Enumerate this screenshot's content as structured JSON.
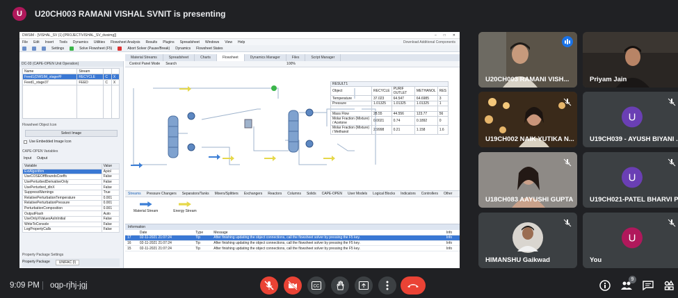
{
  "presenter": {
    "initial": "U",
    "banner": "U20CH003 RAMANI VISHAL SVNIT is presenting"
  },
  "dwsim": {
    "title": "DWSIM - [VISHAL_SV (1) [PROJECT\\VISHAL_SV_dwsimg]]",
    "menu": [
      "File",
      "Edit",
      "Insert",
      "Tools",
      "Dynamics",
      "Utilities",
      "Flowsheet Analysis",
      "Results",
      "Plugins",
      "Spreadsheet",
      "Windows",
      "View",
      "Help"
    ],
    "menu_right": "Download Additional Components",
    "toolbar": [
      "Settings",
      "Solve Flowsheet (F5)",
      "Abort Solver (Pause/Break)",
      "Dynamics",
      "Flowsheet States"
    ],
    "left_title": "DC-03 (CAPE-OPEN Unit Operation)",
    "ports_header": [
      "Name",
      "Stream"
    ],
    "ports": [
      {
        "name": "Feed1(DWSIM_stage#F",
        "stream": "RECYCLE"
      },
      {
        "name": "Feed1_stage37",
        "stream": "FEED"
      }
    ],
    "flowsheet_icon_label": "Flowsheet Object Icon",
    "select_image": "Select Image",
    "embedded_label": "Use Embedded Image Icon",
    "capeopen_vars": "CAPE-OPEN Variables",
    "subtabs": [
      "Input",
      "Output"
    ],
    "var_header": [
      "Variable",
      "Value"
    ],
    "vars": [
      {
        "v": "ExtAlgorithm",
        "val": "Apiol"
      },
      {
        "v": "UseCOSEOffBoundsCoeffs",
        "val": "False"
      },
      {
        "v": "UsePerturbedDerivativeOnly",
        "val": "False"
      },
      {
        "v": "UsePerturbed_dlnX",
        "val": "False"
      },
      {
        "v": "SuppressWarnings",
        "val": "True"
      },
      {
        "v": "RelativePerturbationTemperature",
        "val": "0.001"
      },
      {
        "v": "RelativePerturbationPressure",
        "val": "0.001"
      },
      {
        "v": "PerturbationComposition",
        "val": "0.001"
      },
      {
        "v": "OutputFlash",
        "val": "Auto"
      },
      {
        "v": "UseOnlyXValuesAsInInitial",
        "val": "False"
      },
      {
        "v": "WriteToConsole",
        "val": "False"
      },
      {
        "v": "LogPropertyCalls",
        "val": "False"
      }
    ],
    "prop_settings": "Property Package Settings",
    "prop_package_label": "Property Package",
    "prop_package_value": "UNIFAC (I)",
    "doc_tabs": [
      "Material Streams",
      "Spreadsheet",
      "Charts",
      "Flowsheet",
      "Dynamics Manager",
      "Files",
      "Script Manager"
    ],
    "active_doc_tab": "Flowsheet",
    "fs_toolbar": [
      "Control Panel Mode",
      "Search",
      "100%"
    ],
    "palette_tabs": [
      "Streams",
      "Pressure Changers",
      "Separators/Tanks",
      "Mixers/Splitters",
      "Exchangers",
      "Reactors",
      "Columns",
      "Solids",
      "CAPE-OPEN",
      "User Models",
      "Logical Blocks",
      "Indicators",
      "Controllers",
      "Other"
    ],
    "palette_items": [
      "Material Stream",
      "Energy Stream"
    ],
    "results_title": "RESULT1",
    "results": [
      [
        "Object",
        "RECYCLE",
        "PURIF OUTLET",
        "METHANOL",
        "RES"
      ],
      [
        "Temperature",
        "37.023",
        "64.547",
        "64.6985",
        "3"
      ],
      [
        "Pressure",
        "1.01325",
        "1.01325",
        "1.01325",
        "1"
      ],
      [
        "",
        "",
        "",
        "",
        ""
      ],
      [
        "Mass Flow",
        "28.55",
        "44.556",
        "123.77",
        "56"
      ],
      [
        "Molar Fraction (Mixture) / Acetone",
        "0.0021",
        "0.74",
        "0.1892",
        "0"
      ],
      [
        "Molar Fraction (Mixture) / Methanol",
        "2.9998",
        "0.21",
        "1.158",
        "1.6"
      ]
    ],
    "log_title": "Information",
    "log_header": [
      "",
      "Date",
      "Type",
      "Message",
      "Info"
    ],
    "log_rows": [
      {
        "n": "17",
        "date": "02-11-2021 21:07:24",
        "type": "Tip",
        "msg": "After finishing updating the object connections, call the flowsheet solver by pressing the F5 key.",
        "info": "Info"
      },
      {
        "n": "16",
        "date": "02-11-2021 21:07:24",
        "type": "Tip",
        "msg": "After finishing updating the object connections, call the flowsheet solver by pressing the F5 key.",
        "info": "Info"
      },
      {
        "n": "15",
        "date": "02-11-2021 21:07:24",
        "type": "Tip",
        "msg": "After finishing updating the object connections, call the flowsheet solver by pressing the F5 key.",
        "info": "Info"
      }
    ]
  },
  "participants": [
    {
      "name": "U20CH003 RAMANI VISH...",
      "kind": "video-self",
      "speaking": true
    },
    {
      "name": "Priyam Jain",
      "kind": "video",
      "muted": false
    },
    {
      "name": "U19CH002 NAIK YUTIKA N...",
      "kind": "video",
      "muted": true
    },
    {
      "name": "U19CH039 - AYUSH BIYANI ...",
      "kind": "avatar",
      "initial": "U",
      "color": "#6a3fb4",
      "muted": true
    },
    {
      "name": "U18CH083 AAYUSHI GUPTA",
      "kind": "video",
      "muted": true
    },
    {
      "name": "U19CH021-PATEL BHARVI P...",
      "kind": "avatar",
      "initial": "U",
      "color": "#6a3fb4",
      "muted": true
    },
    {
      "name": "HIMANSHU Gaikwad",
      "kind": "photo",
      "muted": true
    },
    {
      "name": "You",
      "kind": "avatar",
      "initial": "U",
      "color": "#b0185b",
      "muted": true
    }
  ],
  "bottom": {
    "time": "9:09 PM",
    "code": "oqp-rjhj-jgj",
    "participant_count": "9"
  },
  "colors": {
    "bg": "#202124",
    "tile": "#3c4043",
    "red": "#ea4335",
    "blue": "#1a73e8"
  }
}
